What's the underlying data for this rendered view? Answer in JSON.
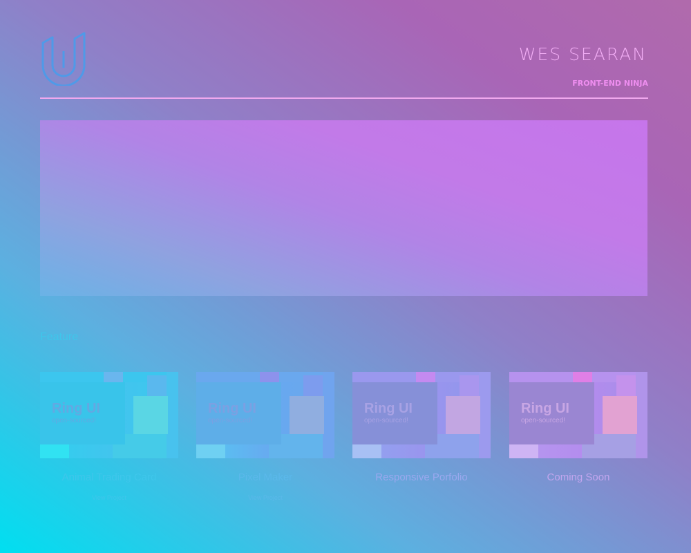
{
  "header": {
    "logo_icon": "udacity-u-logo-icon",
    "owner_name": "WES SEARAN",
    "owner_title": "FRONT-END NINJA"
  },
  "hero": {},
  "section": {
    "heading": "Feature"
  },
  "projects": [
    {
      "title": "Animal Trading Card",
      "link": "View Project",
      "thumb_title": "Ring UI",
      "thumb_subtitle": "open-sourced!",
      "accent": "#3fc6eb"
    },
    {
      "title": "Pixel Maker",
      "link": "View Project",
      "thumb_title": "Ring UI",
      "thumb_subtitle": "open-sourced!",
      "accent": "#5bb8ea"
    },
    {
      "title": "Responsive Porfolio",
      "link": "",
      "thumb_title": "Ring UI",
      "thumb_subtitle": "open-sourced!",
      "accent": "#9aa8ee"
    },
    {
      "title": "Coming Soon",
      "link": "",
      "thumb_title": "Ring UI",
      "thumb_subtitle": "open-sourced!",
      "accent": "#c2a6ee"
    }
  ],
  "colors": {
    "accent_pink": "#f2aef5",
    "hero_top": "#c675eb",
    "hero_bottom": "#6ab3e6"
  }
}
